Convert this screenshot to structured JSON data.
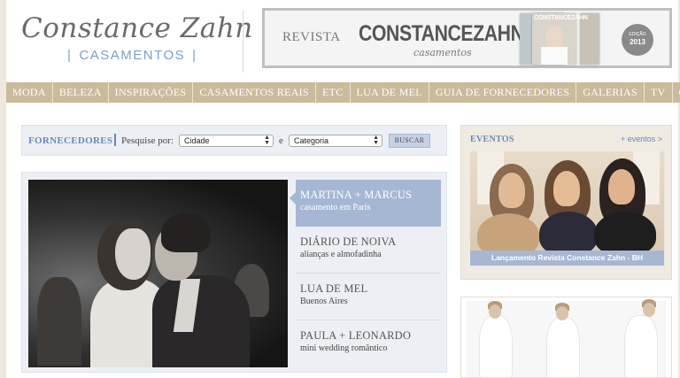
{
  "header": {
    "logo_script": "Constance Zahn",
    "logo_sub": "CASAMENTOS",
    "banner": {
      "revista": "REVISTA",
      "brand": "CONSTANCEZAHN",
      "brand_sub": "casamentos",
      "mag_title": "CONSTANCEZAHN",
      "seal_line1": "EDIÇÃO",
      "seal_line2": "2013"
    }
  },
  "nav": {
    "items": [
      "MODA",
      "BELEZA",
      "INSPIRAÇÕES",
      "CASAMENTOS REAIS",
      "ETC",
      "LUA DE MEL",
      "GUIA DE FORNECEDORES",
      "GALERIAS",
      "TV",
      "GOODIES"
    ]
  },
  "search": {
    "title": "FORNECEDORES",
    "label": "Pesquise por:",
    "city_value": "Cidade",
    "conjunction": "e",
    "category_value": "Categoria",
    "button": "BUSCAR"
  },
  "featured": {
    "items": [
      {
        "title": "MARTINA + MARCUS",
        "subtitle": "casamento em Paris"
      },
      {
        "title": "DIÁRIO DE NOIVA",
        "subtitle": "alianças e almofadinha"
      },
      {
        "title": "LUA DE MEL",
        "subtitle": "Buenos Aires"
      },
      {
        "title": "PAULA + LEONARDO",
        "subtitle": "mini wedding romântico"
      }
    ]
  },
  "events": {
    "title": "EVENTOS",
    "more": "+ eventos >",
    "caption": "Lançamento Revista Constance Zahn - BH"
  },
  "colors": {
    "nav_bg": "#cbbb9b",
    "accent_blue": "#6b88b5",
    "active_item": "#a6b7d3"
  }
}
